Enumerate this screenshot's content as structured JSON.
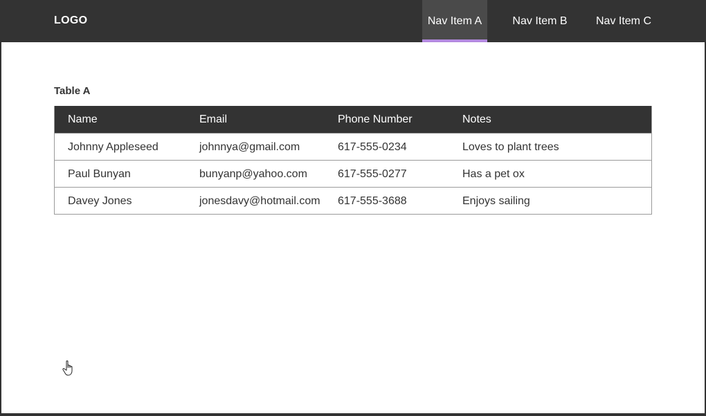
{
  "header": {
    "logo": "LOGO",
    "nav": [
      {
        "label": "Nav Item A",
        "active": true
      },
      {
        "label": "Nav Item B",
        "active": false
      },
      {
        "label": "Nav Item C",
        "active": false
      }
    ],
    "accent_color": "#b48ae0"
  },
  "main": {
    "table_title": "Table A",
    "columns": [
      "Name",
      "Email",
      "Phone Number",
      "Notes"
    ],
    "rows": [
      [
        "Johnny Appleseed",
        "johnnya@gmail.com",
        "617-555-0234",
        "Loves to plant trees"
      ],
      [
        "Paul Bunyan",
        "bunyanp@yahoo.com",
        "617-555-0277",
        "Has a pet ox"
      ],
      [
        "Davey Jones",
        "jonesdavy@hotmail.com",
        "617-555-3688",
        "Enjoys sailing"
      ]
    ]
  },
  "cursor": {
    "icon": "hand-pointer-icon"
  }
}
